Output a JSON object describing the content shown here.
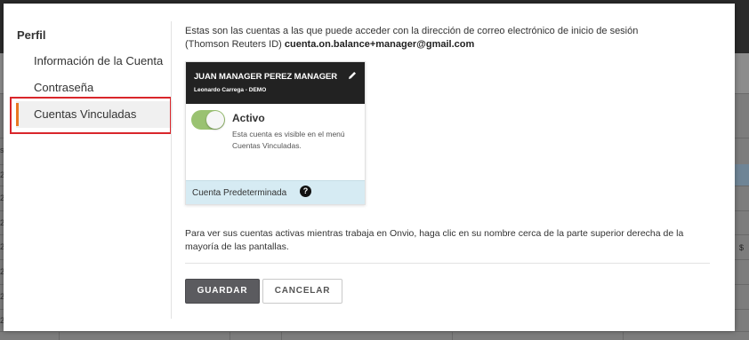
{
  "background": {
    "edge_marks": [
      "s",
      "2",
      "2",
      "2",
      "2",
      "2",
      "2",
      "2"
    ],
    "dollar_mark": "$"
  },
  "sidebar": {
    "title": "Perfil",
    "items": [
      {
        "label": "Información de la Cuenta"
      },
      {
        "label": "Contraseña"
      },
      {
        "label": "Cuentas Vinculadas"
      }
    ]
  },
  "main": {
    "intro_text": "Estas son las cuentas a las que puede acceder con la dirección de correo electrónico de inicio de sesión (Thomson Reuters ID)",
    "email": "cuenta.on.balance+manager@gmail.com",
    "account_card": {
      "name": "JUAN MANAGER PEREZ MANAGER",
      "subtitle": "Leonardo Carrega - DEMO",
      "status_label": "Activo",
      "status_desc": "Esta cuenta es visible en el menú Cuentas Vinculadas.",
      "default_label": "Cuenta Predeterminada",
      "help_symbol": "?",
      "toggle_on": true
    },
    "note": "Para ver sus cuentas activas mientras trabaja en Onvio, haga clic en su nombre cerca de la parte superior derecha de la mayoría de las pantallas."
  },
  "actions": {
    "save_label": "GUARDAR",
    "cancel_label": "CANCELAR"
  },
  "colors": {
    "accent": "#e87722",
    "toggle": "#9ac271",
    "highlight_box": "#d9262b",
    "card_header": "#222222",
    "default_bar": "#d6ebf3"
  },
  "icons": {
    "edit": "pencil-icon",
    "help": "question-circle-icon"
  }
}
